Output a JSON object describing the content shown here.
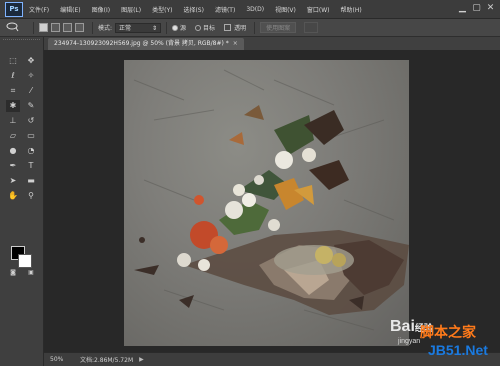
{
  "app": {
    "logo": "Ps",
    "accent": "#7fb3ff"
  },
  "menu": [
    "文件(F)",
    "编辑(E)",
    "图像(I)",
    "图层(L)",
    "类型(Y)",
    "选择(S)",
    "滤镜(T)",
    "3D(D)",
    "视图(V)",
    "窗口(W)",
    "帮助(H)"
  ],
  "window_controls": {
    "minimize": "▁",
    "maximize": "▢",
    "close": "✕"
  },
  "options": {
    "tool_icon": "lasso-icon",
    "feather_label": "模式:",
    "style_value": "正常",
    "radio1_label": "源",
    "radio2_label": "目标",
    "checkbox_label": "透明",
    "button_label": "使用图案"
  },
  "document": {
    "tab_title": "234974-130923092H569.jpg @ 50% (背景 拷贝, RGB/8#) *",
    "close": "×"
  },
  "status": {
    "zoom": "50%",
    "doc_info": "文档:2.86M/5.72M",
    "arrow": "▶"
  },
  "watermark": {
    "brand": "Bai",
    "brand_suffix": "经验",
    "site_cn": "脚本之家",
    "site_url": "jingyan",
    "jb51": "JB51.Net"
  }
}
